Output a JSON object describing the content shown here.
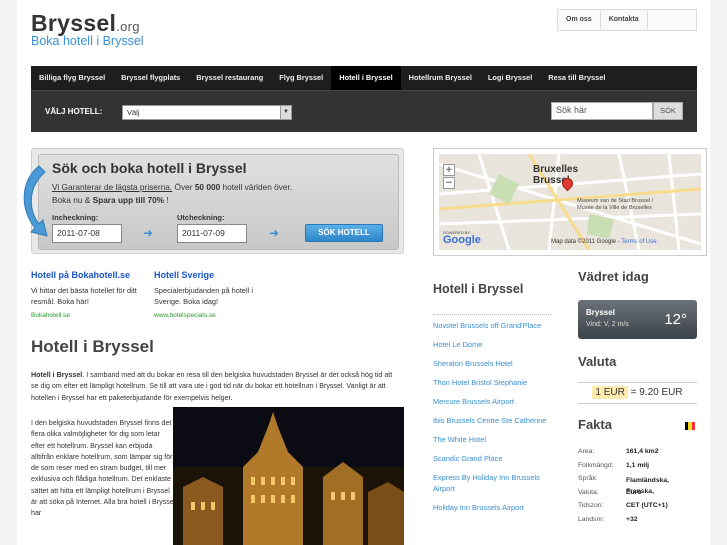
{
  "header": {
    "logo_main": "Bryssel",
    "logo_tld": ".org",
    "tagline": "Boka hotell i Bryssel",
    "toplinks": [
      "Om oss",
      "Kontakta"
    ]
  },
  "nav": [
    "Billiga flyg Bryssel",
    "Bryssel flygplats",
    "Bryssel restaurang",
    "Flyg Bryssel",
    "Hotell i Bryssel",
    "Hotellrum Bryssel",
    "Logi Bryssel",
    "Resa till Bryssel"
  ],
  "nav_active_index": 4,
  "hotelbar": {
    "label": "VÄLJ HOTELL:",
    "select_value": "Välj",
    "search_placeholder": "Sök här",
    "search_button": "SÖK"
  },
  "booking": {
    "title": "Sök och boka hotell i Bryssel",
    "line1_link": "Vi Garanterar de lägsta priserna.",
    "line1_rest_a": " Över ",
    "line1_bold": "50 000",
    "line1_rest_b": " hotell världen över.",
    "line2_a": "Boka nu & ",
    "line2_bold": "Spara upp till 70%",
    "line2_b": " !",
    "checkin_label": "Incheckning:",
    "checkout_label": "Utcheckning:",
    "checkin_value": "2011-07-08",
    "checkout_value": "2011-07-09",
    "submit": "SÖK HOTELL"
  },
  "map": {
    "city_label_1": "Bruxelles",
    "city_label_2": "Brussel",
    "poi": "Museum van de Stad Brussel / Musée de la Ville de Bruxelles",
    "powered": "POWERED BY",
    "google": "Google",
    "credits": "Map data ©2011 Google -",
    "terms": "Terms of Use"
  },
  "ads": [
    {
      "title": "Hotell på Bokahotell.se",
      "desc": "Vi hittar det bästa hotellet för ditt resmål. Boka här!",
      "url": "Bokahotell.se"
    },
    {
      "title": "Hotell Sverige",
      "desc": "Specialerbjudanden på hotell i Sverige. Boka idag!",
      "url": "www.hotelspecials.se"
    }
  ],
  "article": {
    "heading": "Hotell i Bryssel",
    "intro_bold": "Hotell i Bryssel",
    "intro_rest": ". I samband med att du bokar en resa till den belgiska huvudstaden Bryssel är det också hög tid att se dig om efter ett lämpligt hotellrum. Se till att vara ute i god tid när du bokar ett hotellrum i Bryssel. Vanligt är att hotellen i Bryssel har ett paketerbjudande för exempelvis helger.",
    "para2": "I den belgiska huvudstaden Bryssel finns det flera olika valmöjligheter för dig som letar efter ett hotellrum. Bryssel kan erbjuda alltifrån enklare hotellrum, som lämpar sig för de som reser med en stram budget, till mer exklusiva och flådiga hotellrum. Det enklaste sättet att hitta ett lämpligt hotellrum i Bryssel är att söka på Internet. Alla bra hotell i Bryssel har"
  },
  "hotel_list": {
    "heading": "Hotell i Bryssel",
    "items": [
      "Novotel Brussels off Grand'Place",
      "Hotel Le Dome",
      "Sheraton Brussels Hotel",
      "Thon Hotel Bristol Stephanie",
      "Mercure Brussels Airport",
      "Ibis Brussels Centre Ste Catherine",
      "The White Hotel",
      "Scandic Grand Place",
      "Express By Holiday Inn Brussels Airport",
      "Holiday Inn Brussels Airport"
    ]
  },
  "weather": {
    "heading": "Vädret idag",
    "city": "Bryssel",
    "wind": "Vind: V, 2 m/s",
    "temp": "12°"
  },
  "currency": {
    "heading": "Valuta",
    "rate_left": "1 EUR",
    "eq": " = ",
    "rate_right": "9.20 EUR"
  },
  "facts": {
    "heading": "Fakta",
    "flag_colors": [
      "#000000",
      "#FDDA24",
      "#EF3340"
    ],
    "rows": [
      {
        "k": "Area:",
        "v": "161,4 km2"
      },
      {
        "k": "Folkmängd:",
        "v": "1,1 milj"
      },
      {
        "k": "Språk:",
        "v": "Flamländska, Franska,"
      },
      {
        "k": "Valuta:",
        "v": "Euro"
      },
      {
        "k": "Tidszon:",
        "v": "CET (UTC+1)"
      },
      {
        "k": "Landsnr:",
        "v": "+32"
      }
    ]
  }
}
